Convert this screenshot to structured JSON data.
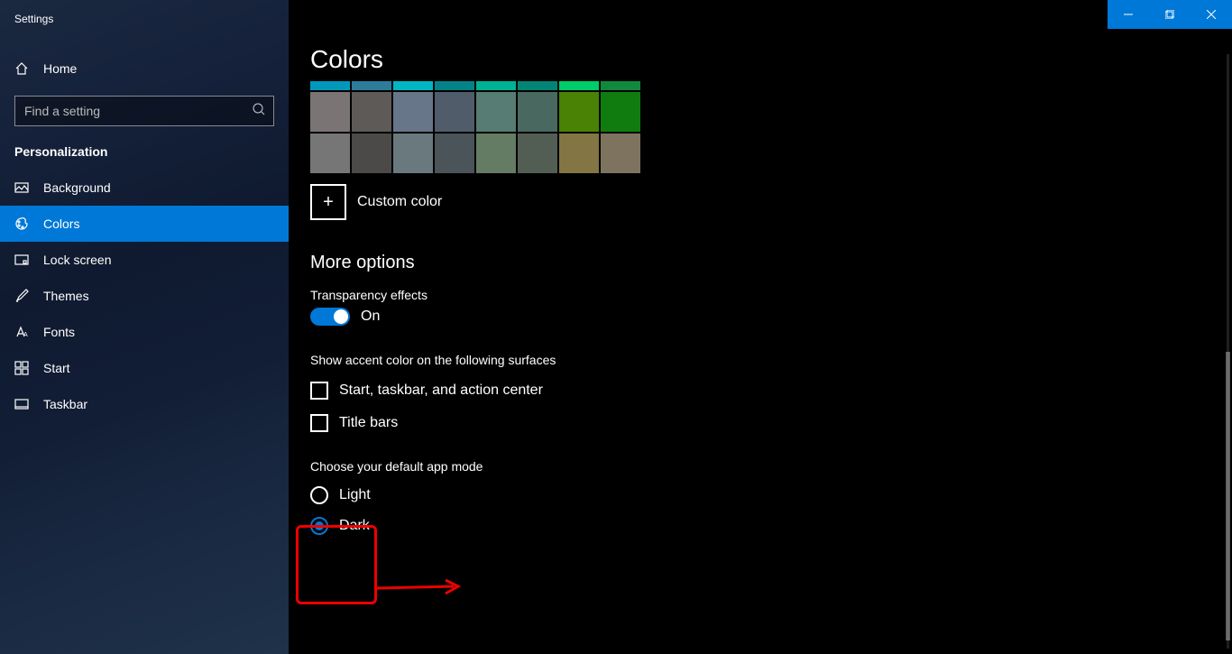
{
  "app_title": "Settings",
  "titlebar": {
    "minimize": "Minimize",
    "maximize": "Restore",
    "close": "Close"
  },
  "nav": {
    "home": "Home",
    "search_placeholder": "Find a setting",
    "section": "Personalization",
    "items": [
      {
        "key": "background",
        "label": "Background"
      },
      {
        "key": "colors",
        "label": "Colors"
      },
      {
        "key": "lockscreen",
        "label": "Lock screen"
      },
      {
        "key": "themes",
        "label": "Themes"
      },
      {
        "key": "fonts",
        "label": "Fonts"
      },
      {
        "key": "start",
        "label": "Start"
      },
      {
        "key": "taskbar",
        "label": "Taskbar"
      }
    ],
    "active": "colors"
  },
  "page": {
    "title": "Colors",
    "swatches": {
      "row_partial": [
        "#0099bc",
        "#2d7d9a",
        "#00b7c3",
        "#038387",
        "#00b294",
        "#018574",
        "#00cc6a",
        "#10893e"
      ],
      "row2": [
        "#7a7574",
        "#5d5a58",
        "#68768a",
        "#515c6b",
        "#567c73",
        "#486860",
        "#498205",
        "#107c10"
      ],
      "row3": [
        "#767676",
        "#4c4a48",
        "#69797e",
        "#4a5459",
        "#647c64",
        "#525e54",
        "#847545",
        "#7e735f"
      ]
    },
    "custom_color": "Custom color",
    "more_options": "More options",
    "transparency_label": "Transparency effects",
    "transparency_state": "On",
    "accent_surfaces_label": "Show accent color on the following surfaces",
    "checks": [
      {
        "label": "Start, taskbar, and action center",
        "checked": false
      },
      {
        "label": "Title bars",
        "checked": false
      }
    ],
    "app_mode_label": "Choose your default app mode",
    "app_mode_options": [
      {
        "label": "Light",
        "selected": false
      },
      {
        "label": "Dark",
        "selected": true
      }
    ]
  },
  "accent_color": "#0078d7"
}
